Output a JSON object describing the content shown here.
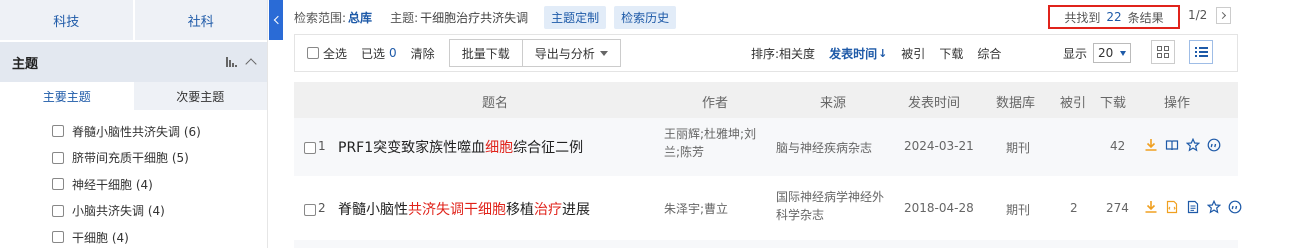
{
  "sidebar": {
    "subject_tabs": [
      "科技",
      "社科"
    ],
    "topic_title": "主题",
    "sub_tabs": {
      "primary": "主要主题",
      "secondary": "次要主题"
    },
    "facets": [
      "脊髓小脑性共济失调 (6)",
      "脐带间充质干细胞 (5)",
      "神经干细胞 (4)",
      "小脑共济失调 (4)",
      "干细胞 (4)"
    ]
  },
  "scope": {
    "scope_label": "检索范围:",
    "scope_value": "总库",
    "topic_label": "主题:",
    "topic_value": "干细胞治疗共济失调",
    "btn_custom": "主题定制",
    "btn_history": "检索历史"
  },
  "results": {
    "prefix": "共找到",
    "count": "22",
    "suffix": "条结果",
    "page": "1/2"
  },
  "toolbar": {
    "select_all": "全选",
    "selected_label": "已选",
    "selected_count": "0",
    "clear": "清除",
    "batch_download": "批量下载",
    "export_analyze": "导出与分析",
    "sort_label": "排序:",
    "sort_relevance": "相关度",
    "sort_date": "发表时间",
    "sort_date_arrow": "↓",
    "sort_cited": "被引",
    "sort_download": "下载",
    "sort_overall": "综合",
    "display_label": "显示",
    "display_value": "20"
  },
  "table": {
    "headers": {
      "title": "题名",
      "author": "作者",
      "source": "来源",
      "date": "发表时间",
      "db": "数据库",
      "cited": "被引",
      "download": "下载",
      "ops": "操作"
    },
    "rows": [
      {
        "index": "1",
        "title_parts": [
          "PRF1突变致家族性噬血",
          "细胞",
          "综合征二例"
        ],
        "authors": "王丽辉;杜雅坤;刘兰;陈芳",
        "source": "脑与神经疾病杂志",
        "date": "2024-03-21",
        "db": "期刊",
        "cited": "",
        "download": "42"
      },
      {
        "index": "2",
        "title_parts": [
          "脊髓小脑性",
          "共济失调干细胞",
          "移植",
          "治疗",
          "进展"
        ],
        "authors": "朱泽宇;曹立",
        "source": "国际神经病学神经外科学杂志",
        "date": "2018-04-28",
        "db": "期刊",
        "cited": "2",
        "download": "274"
      }
    ]
  },
  "colors": {
    "accent": "#1e5aa8",
    "highlight": "#e0231b",
    "download_icon": "#f0a020"
  }
}
